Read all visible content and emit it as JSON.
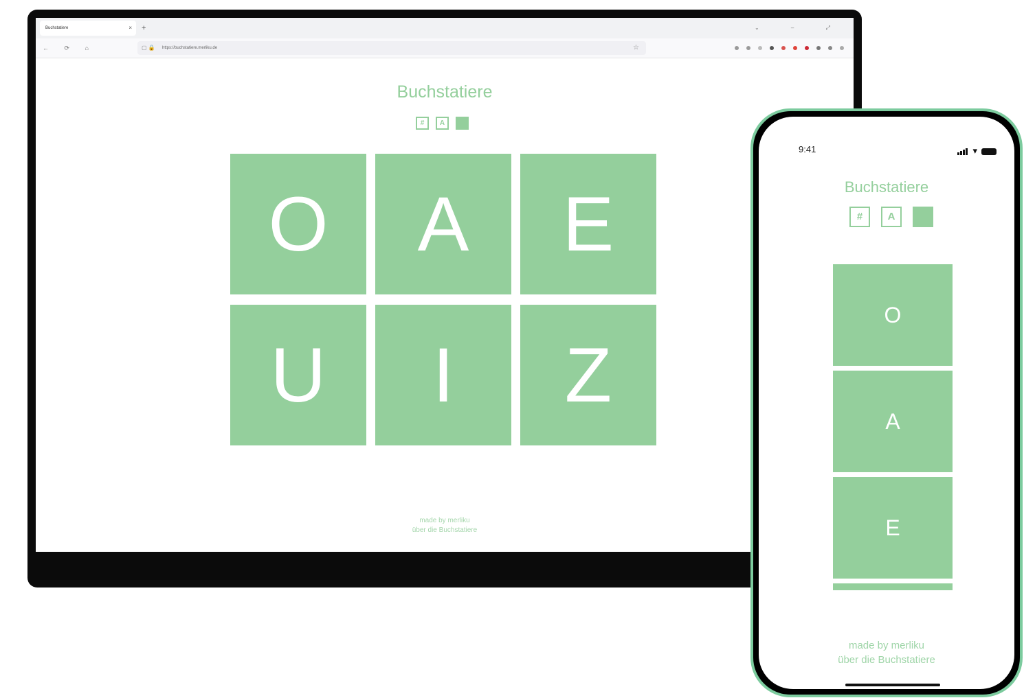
{
  "laptop": {
    "browser": {
      "tab_title": "Buchstatiere",
      "tab_close": "×",
      "new_tab": "+",
      "window_controls": "⌄ – ⤢",
      "nav": "← ⟳ ⌂",
      "url_icons": "▢ 🔒",
      "url": "https://buchstatiere.merliku.de",
      "star": "☆"
    },
    "app": {
      "title": "Buchstatiere",
      "modes": [
        "#",
        "A",
        ""
      ],
      "letters": [
        "O",
        "A",
        "E",
        "U",
        "I",
        "Z"
      ],
      "footer_line1": "made by merliku",
      "footer_line2": "über die Buchstatiere"
    }
  },
  "phone": {
    "status_time": "9:41",
    "wifi": "▾",
    "app": {
      "title": "Buchstatiere",
      "modes": [
        "#",
        "A",
        ""
      ],
      "letters": [
        "O",
        "A",
        "E"
      ],
      "footer_line1": "made by merliku",
      "footer_line2": "über die Buchstatiere"
    }
  },
  "colors": {
    "accent": "#94cf9c",
    "frame": "#0b0b0b",
    "phone_rim": "#7ccb9e"
  }
}
